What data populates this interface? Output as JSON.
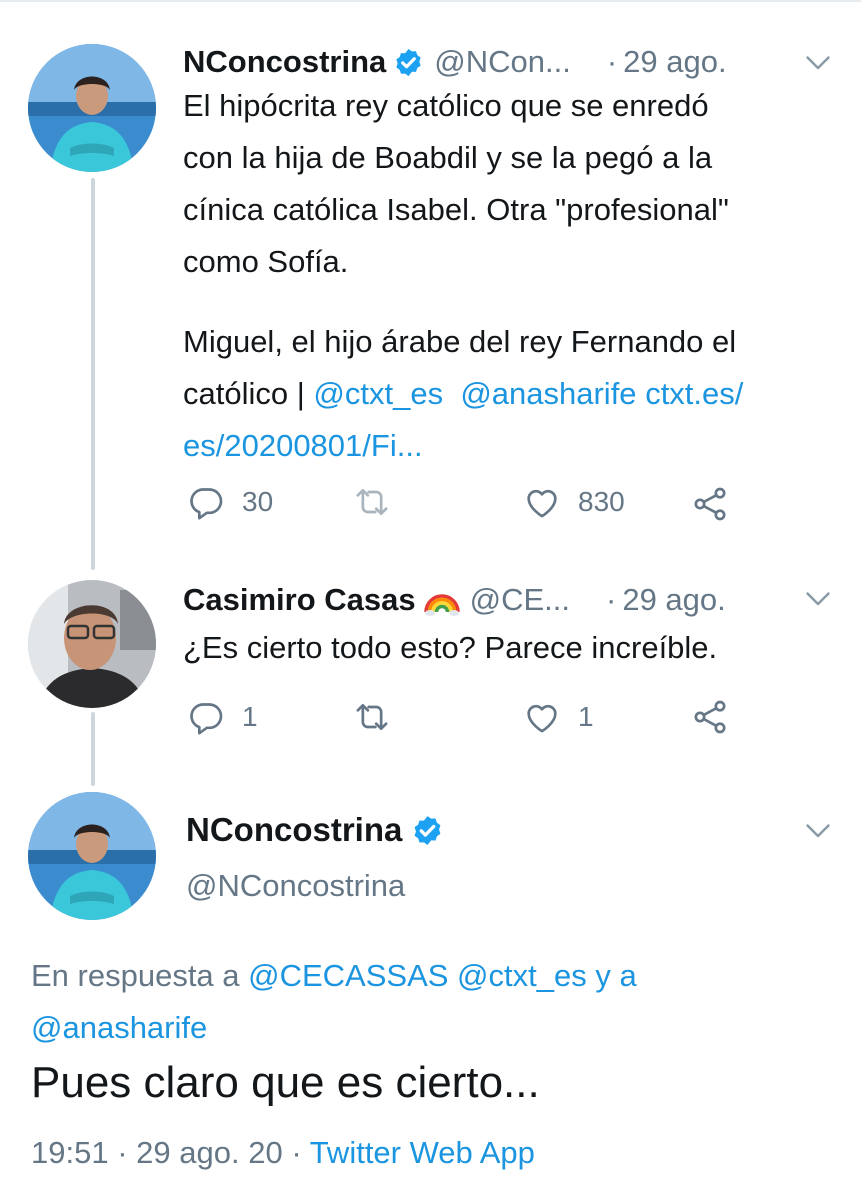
{
  "colors": {
    "text": "#14171a",
    "secondary": "#657786",
    "link": "#1b95e0",
    "verified": "#1da1f2",
    "thread_line": "#ccd6dd"
  },
  "tweet1": {
    "name": "NConcostrina",
    "handle": "@NCon...",
    "separator": "·",
    "date": "29 ago.",
    "text_lines": [
      "El hipócrita rey católico que se enredó",
      "con la hija de Boabdil y se la pegó a la",
      "cínica católica Isabel. Otra \"profesional\"",
      "como Sofía."
    ],
    "text2_line1": "Miguel, el hijo árabe del rey Fernando el",
    "text2_prefix": "católico | ",
    "mention1": "@ctxt_es",
    "mention2": "@anasharife",
    "link_part1": "ctxt.es/",
    "link_part2": "es/20200801/Fi...",
    "replies": "30",
    "retweets": "",
    "likes": "830",
    "icons": [
      "avatar",
      "verified-badge-icon",
      "chevron-down-icon",
      "reply-icon",
      "retweet-icon",
      "like-icon",
      "share-icon"
    ]
  },
  "tweet2": {
    "name": "Casimiro Casas",
    "handle": "@CE...",
    "separator": "·",
    "date": "29 ago.",
    "text": "¿Es cierto todo esto? Parece increíble.",
    "replies": "1",
    "retweets": "",
    "likes": "1",
    "icons": [
      "avatar",
      "rainbow-emoji",
      "chevron-down-icon",
      "reply-icon",
      "retweet-icon",
      "like-icon",
      "share-icon"
    ]
  },
  "main_tweet": {
    "name": "NConcostrina",
    "handle": "@NConcostrina",
    "reply_prefix": "En respuesta a ",
    "reply_mentions_a": "@CECASSAS @ctxt_es",
    "reply_and": " y a",
    "reply_mention_b": "@anasharife",
    "text": "Pues claro que es cierto...",
    "time": "19:51",
    "separator": "·",
    "date": "29 ago. 20",
    "source": "Twitter Web App"
  }
}
